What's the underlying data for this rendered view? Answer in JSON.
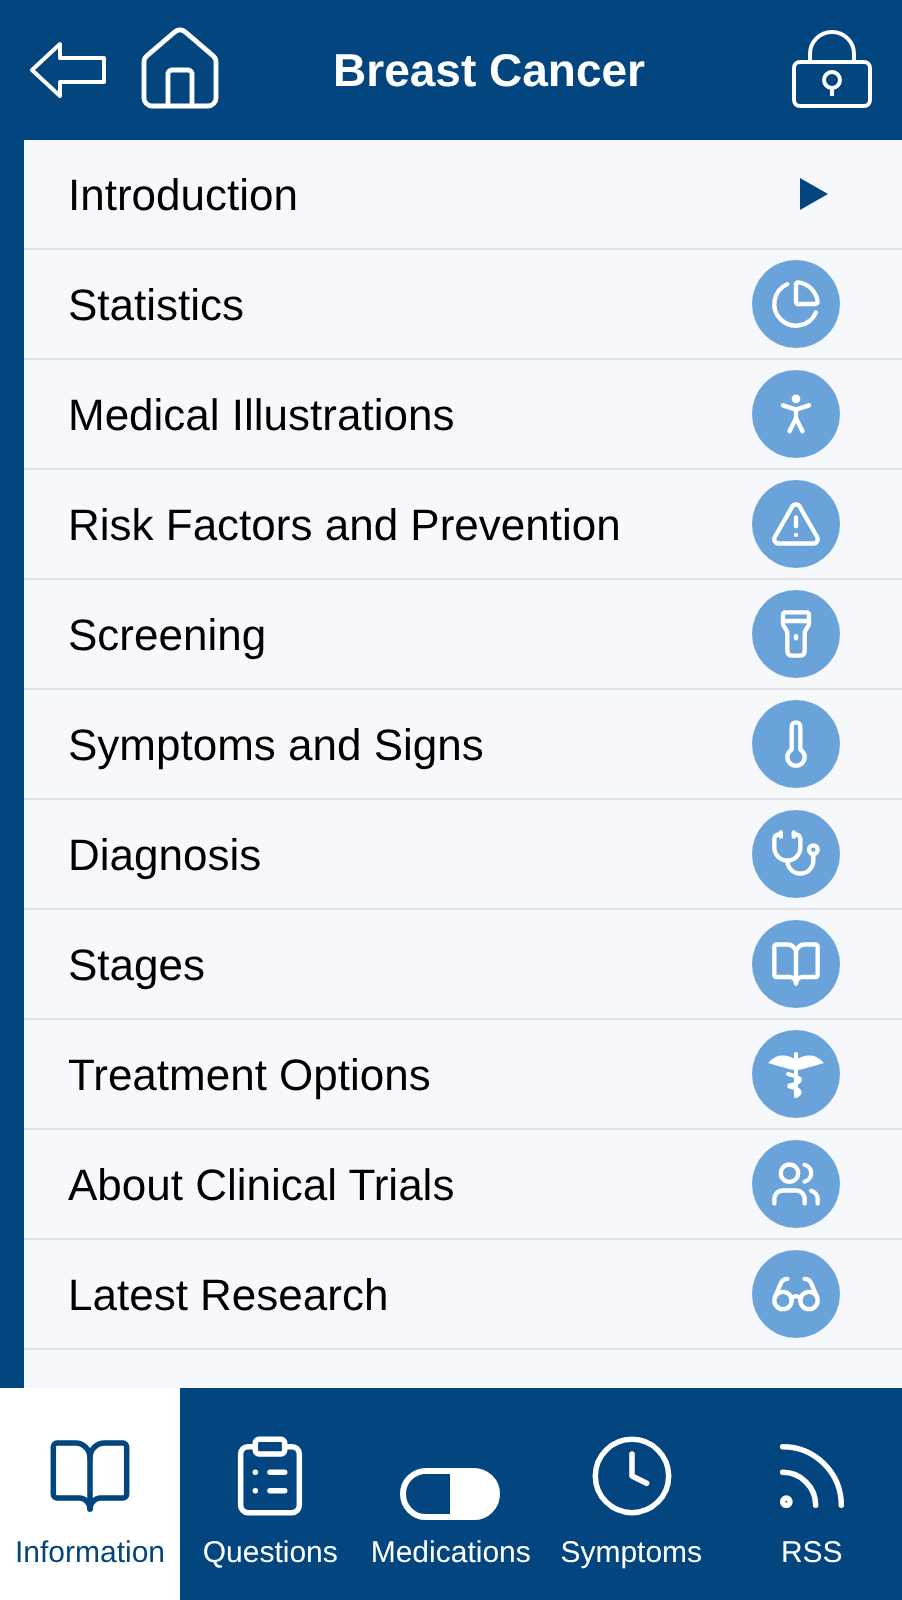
{
  "header": {
    "title": "Breast Cancer"
  },
  "menu": [
    {
      "label": "Introduction",
      "kind": "arrow"
    },
    {
      "label": "Statistics",
      "kind": "pie"
    },
    {
      "label": "Medical Illustrations",
      "kind": "body"
    },
    {
      "label": "Risk Factors and Prevention",
      "kind": "warning"
    },
    {
      "label": "Screening",
      "kind": "flashlight"
    },
    {
      "label": "Symptoms and Signs",
      "kind": "thermometer"
    },
    {
      "label": "Diagnosis",
      "kind": "stethoscope"
    },
    {
      "label": "Stages",
      "kind": "book"
    },
    {
      "label": "Treatment Options",
      "kind": "caduceus"
    },
    {
      "label": "About Clinical Trials",
      "kind": "people"
    },
    {
      "label": "Latest Research",
      "kind": "glasses"
    }
  ],
  "tabs": [
    {
      "label": "Information",
      "kind": "book",
      "selected": true
    },
    {
      "label": "Questions",
      "kind": "clipboard",
      "selected": false
    },
    {
      "label": "Medications",
      "kind": "pill",
      "selected": false
    },
    {
      "label": "Symptoms",
      "kind": "clock",
      "selected": false
    },
    {
      "label": "RSS",
      "kind": "rss",
      "selected": false
    }
  ]
}
